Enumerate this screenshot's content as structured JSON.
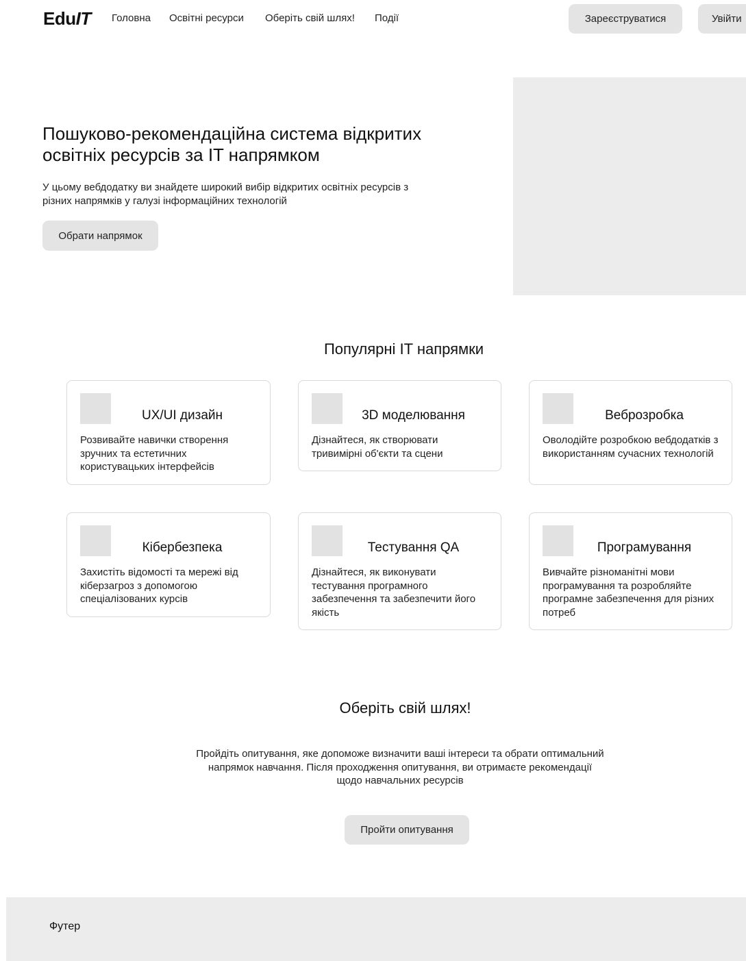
{
  "header": {
    "logo_prefix": "Edu",
    "logo_suffix": "IT",
    "nav": [
      "Головна",
      "Освітні ресурси",
      "Оберіть свій шлях!",
      "Події"
    ],
    "register_label": "Зареєструватися",
    "login_label": "Увійти"
  },
  "hero": {
    "title": "Пошуково-рекомендаційна система відкритих освітніх ресурсів за IT напрямком",
    "description": "У цьому вебдодатку ви знайдете широкий вибір відкритих освітніх ресурсів з різних напрямків у галузі інформаційних технологій",
    "button_label": "Обрати напрямок"
  },
  "popular": {
    "title": "Популярні IT напрямки",
    "cards": [
      {
        "title": "UX/UI дизайн",
        "description": "Розвивайте навички створення зручних та естетичних користувацьких інтерфейсів"
      },
      {
        "title": "3D моделювання",
        "description": "Дізнайтеся, як створювати тривимірні об'єкти та сцени"
      },
      {
        "title": "Веброзробка",
        "description": "Оволодійте розробкою вебдодатків з використанням сучасних технологій"
      },
      {
        "title": "Кібербезпека",
        "description": "Захистіть відомості та мережі від кіберзагроз з допомогою спеціалізованих курсів"
      },
      {
        "title": "Тестування QA",
        "description": "Дізнайтеся, як виконувати тестування програмного забезпечення та забезпечити його якість"
      },
      {
        "title": "Програмування",
        "description": "Вивчайте різноманітні мови програмування та розробляйте програмне забезпечення для різних потреб"
      }
    ]
  },
  "path": {
    "title": "Оберіть свій шлях!",
    "description": "Пройдіть опитування, яке допоможе визначити ваші інтереси та обрати оптимальний напрямок навчання. Після проходження опитування, ви отримаєте рекомендації щодо навчальних ресурсів",
    "button_label": "Пройти опитування"
  },
  "footer": {
    "label": "Футер"
  },
  "colors": {
    "button_bg": "#e4e4e4",
    "placeholder_bg": "#ececec",
    "card_border": "#d9d9d9"
  }
}
